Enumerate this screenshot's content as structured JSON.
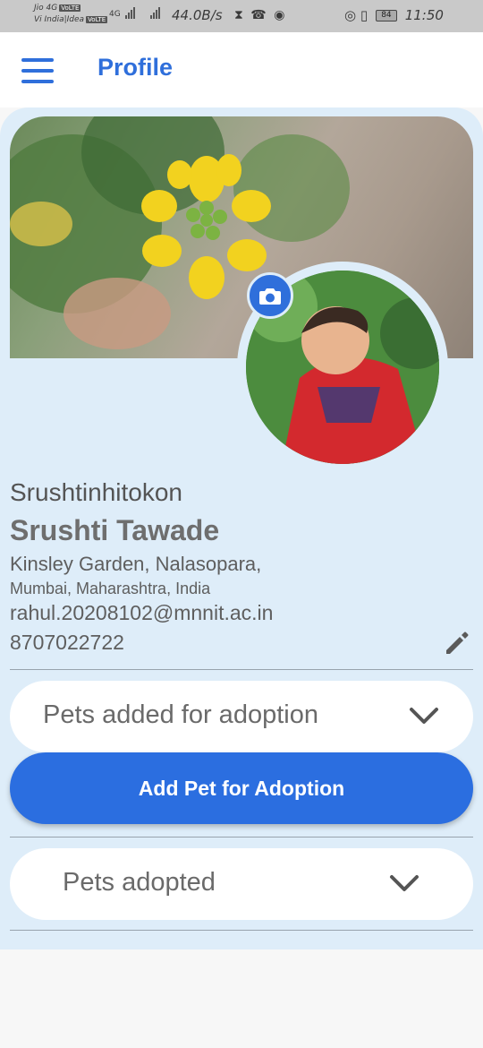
{
  "status_bar": {
    "sim1": "Jio 4G",
    "sim1_tag": "VoLTE",
    "sim2": "Vi India|Idea",
    "sim2_tag": "VoLTE",
    "network": "4G",
    "speed": "44.0B/s",
    "battery": "84",
    "time": "11:50"
  },
  "appbar": {
    "title": "Profile",
    "menu_icon": "menu-icon"
  },
  "profile": {
    "username": "Srushtinhitokon",
    "name": "Srushti Tawade",
    "address_line1": "Kinsley Garden, Nalasopara,",
    "address_line2": "Mumbai, Maharashtra, India",
    "email": "rahul.20208102@mnnit.ac.in",
    "phone": "8707022722"
  },
  "sections": {
    "pets_added_label": "Pets added for adoption",
    "add_pet_button": "Add Pet for Adoption",
    "pets_adopted_label": "Pets adopted"
  },
  "colors": {
    "accent": "#2f6fdb",
    "card_background": "#deedf9",
    "button": "#2b6ee0"
  }
}
